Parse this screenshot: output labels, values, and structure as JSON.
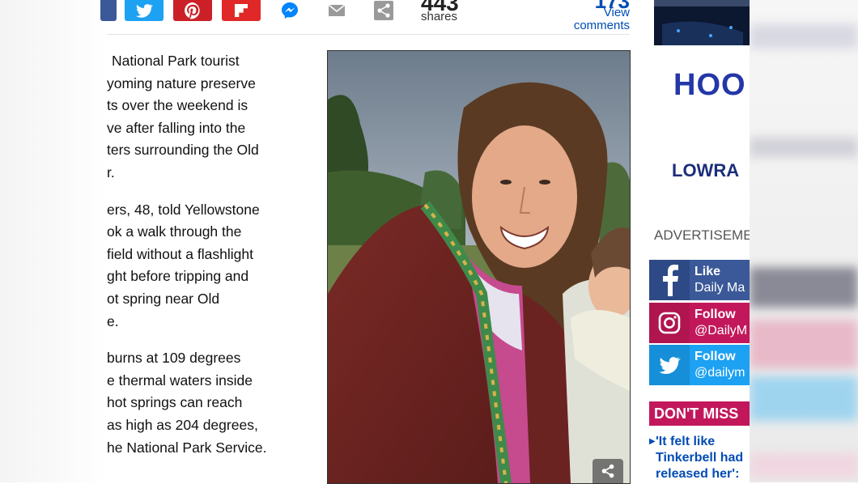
{
  "share_bar": {
    "buttons": [
      {
        "name": "facebook",
        "color": "#3b5998"
      },
      {
        "name": "twitter",
        "color": "#1da1f2"
      },
      {
        "name": "pinterest",
        "color": "#cb2027"
      },
      {
        "name": "flipboard",
        "color": "#e12828"
      },
      {
        "name": "messenger",
        "color": "#ffffff"
      },
      {
        "name": "email",
        "color": "#ffffff"
      },
      {
        "name": "share",
        "color": "#ffffff"
      }
    ],
    "shares_count": "443",
    "shares_label": "shares",
    "comments_count": "173",
    "view_label": "View",
    "comments_label": "comments"
  },
  "article": {
    "paragraphs": [
      [
        "National Park tourist",
        "yoming nature preserve",
        "ts over the weekend is",
        "ve after falling into the",
        "ters surrounding the Old",
        "r."
      ],
      [
        "ers, 48, told Yellowstone",
        "ok a walk through the",
        "field without a flashlight",
        "ght before tripping and",
        "ot spring near Old",
        "e."
      ],
      [
        "burns at 109 degrees",
        "e thermal waters inside",
        "hot springs can reach",
        "as high as 204 degrees,",
        "he National Park Service."
      ]
    ]
  },
  "rail": {
    "ad_brand_1": "HOO",
    "ad_brand_2": "LOWRA",
    "advertisement_label": "ADVERTISEME",
    "social": [
      {
        "network": "facebook",
        "line1": "Like",
        "line2": "Daily Ma",
        "color": "#3b5998"
      },
      {
        "network": "instagram",
        "line1": "Follow",
        "line2": "@DailyM",
        "color": "#c2185b"
      },
      {
        "network": "twitter",
        "line1": "Follow",
        "line2": "@dailym",
        "color": "#1da1f2"
      }
    ],
    "dont_miss_label": "DON'T MISS",
    "dont_miss_story": [
      "'It felt like",
      "Tinkerbell had",
      "released her':"
    ]
  }
}
